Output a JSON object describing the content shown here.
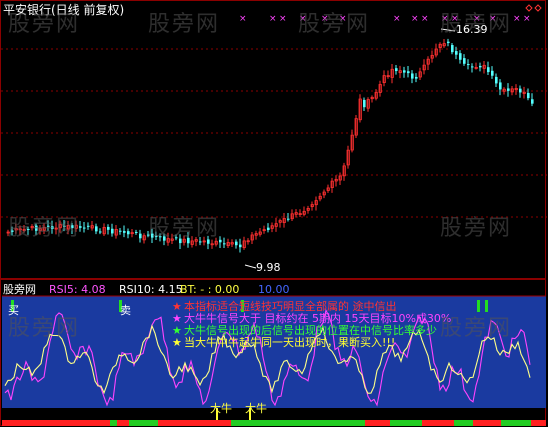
{
  "header": {
    "title": "平安银行(日线 前复权)"
  },
  "main_chart": {
    "high_label": "16.39",
    "low_label": "9.98",
    "colors": {
      "up": "#ff3030",
      "down": "#54ffff",
      "grid": "#8b0000",
      "marker": "#ff44ff"
    }
  },
  "indicator": {
    "name": "股旁网",
    "rsi5_label": "RSI5: 4.08",
    "rsi10_label": "RSI10: 4.15",
    "bt_label": "BT: - : 0.00",
    "extra_value": "10.00",
    "buy_label": "买",
    "sell_label": "卖",
    "bull_labels": [
      "大牛",
      "大牛"
    ],
    "notes": [
      {
        "star": "★",
        "star_color": "#ff3333",
        "text": "本指标适合短线技巧明显全部属的 途中信出",
        "color": "#ff3333"
      },
      {
        "star": "★",
        "star_color": "#ff44ff",
        "text": "大牛牛信号大于 目标约在 5期内 15天目标10%成30%",
        "color": "#ff44ff"
      },
      {
        "star": "★",
        "star_color": "#33ff33",
        "text": "大牛信号出现的后信号出现的位置在中信号比率多少",
        "color": "#33ff33"
      },
      {
        "star": "★",
        "star_color": "#ffff33",
        "text": "当大牛中牛起牛同一天出现时，果断买入!!!",
        "color": "#ffff33"
      }
    ]
  },
  "watermarks": [
    "股旁网",
    "股旁网",
    "股旁网",
    "股旁网",
    "股旁网",
    "股旁网",
    "股旁网",
    "股旁网",
    "股旁网"
  ]
}
